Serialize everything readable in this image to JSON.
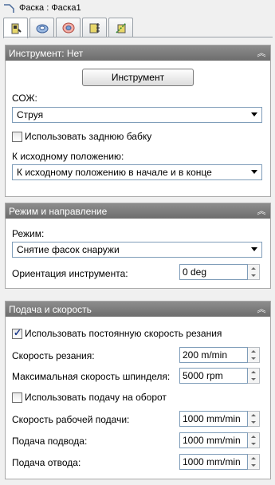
{
  "window": {
    "title": "Фаска : Фаска1"
  },
  "tabs": [
    {
      "icon": "tool-icon",
      "active": true
    },
    {
      "icon": "geometry-icon",
      "active": false
    },
    {
      "icon": "heights-icon",
      "active": false
    },
    {
      "icon": "passes-icon",
      "active": false
    },
    {
      "icon": "linking-icon",
      "active": false
    }
  ],
  "tool_panel": {
    "title": "Инструмент: Нет",
    "tool_button": "Инструмент",
    "coolant_label": "СОЖ:",
    "coolant_value": "Струя",
    "tailstock_label": "Использовать заднюю бабку",
    "tailstock_checked": false,
    "home_label": "К исходному положению:",
    "home_value": "К исходному положению в начале и в конце"
  },
  "mode_panel": {
    "title": "Режим и направление",
    "mode_label": "Режим:",
    "mode_value": "Снятие фасок снаружи",
    "orientation_label": "Ориентация инструмента:",
    "orientation_value": "0 deg"
  },
  "feed_panel": {
    "title": "Подача и скорость",
    "css_label": "Использовать постоянную скорость резания",
    "css_checked": true,
    "surface_speed_label": "Скорость резания:",
    "surface_speed_value": "200 m/min",
    "max_spindle_label": "Максимальная скорость шпинделя:",
    "max_spindle_value": "5000 rpm",
    "feed_per_rev_label": "Использовать подачу на оборот",
    "feed_per_rev_checked": false,
    "cutting_feed_label": "Скорость рабочей подачи:",
    "cutting_feed_value": "1000 mm/min",
    "lead_in_label": "Подача подвода:",
    "lead_in_value": "1000 mm/min",
    "lead_out_label": "Подача отвода:",
    "lead_out_value": "1000 mm/min"
  },
  "colors": {
    "panel_header": "#7a7a7a",
    "check_mark": "#1c3a8c"
  }
}
